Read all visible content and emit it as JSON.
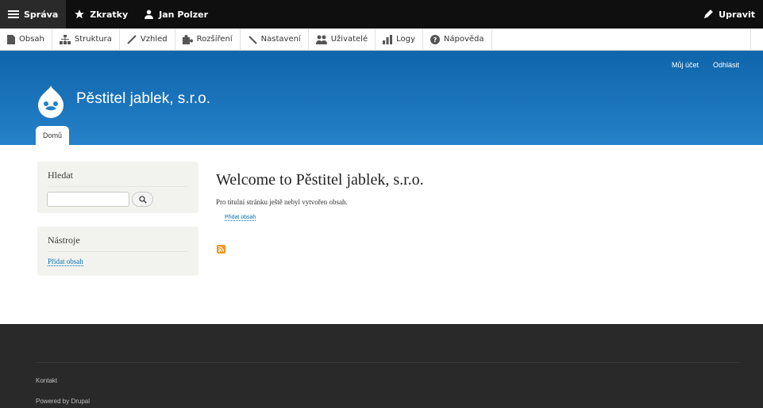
{
  "toolbar": {
    "manage": "Správa",
    "shortcuts": "Zkratky",
    "user": "Jan Polzer",
    "edit": "Upravit"
  },
  "admin_menu": [
    {
      "label": "Obsah",
      "icon": "file-icon"
    },
    {
      "label": "Struktura",
      "icon": "sitemap-icon"
    },
    {
      "label": "Vzhled",
      "icon": "brush-icon"
    },
    {
      "label": "Rozšíření",
      "icon": "puzzle-icon"
    },
    {
      "label": "Nastavení",
      "icon": "wrench-icon"
    },
    {
      "label": "Uživatelé",
      "icon": "users-icon"
    },
    {
      "label": "Logy",
      "icon": "bar-chart-icon"
    },
    {
      "label": "Nápověda",
      "icon": "help-icon"
    }
  ],
  "header": {
    "account_link": "Můj účet",
    "logout_link": "Odhlásit",
    "site_name": "Pěstitel jablek, s.r.o.",
    "tab_home": "Domů"
  },
  "sidebar": {
    "search_title": "Hledat",
    "search_value": "",
    "tools_title": "Nástroje",
    "tools_link": "Přidat obsah"
  },
  "content": {
    "title": "Welcome to Pěstitel jablek, s.r.o.",
    "empty_text": "Pro titulní stránku ještě nebyl vytvořen obsah.",
    "add_content": "Přidat obsah"
  },
  "footer": {
    "contact": "Kontakt",
    "powered": "Powered by Drupal"
  },
  "colors": {
    "header_top": "#0f65aa",
    "header_bottom": "#2581c9",
    "link": "#0071b3",
    "footer": "#292929",
    "feed": "#f7931e"
  }
}
